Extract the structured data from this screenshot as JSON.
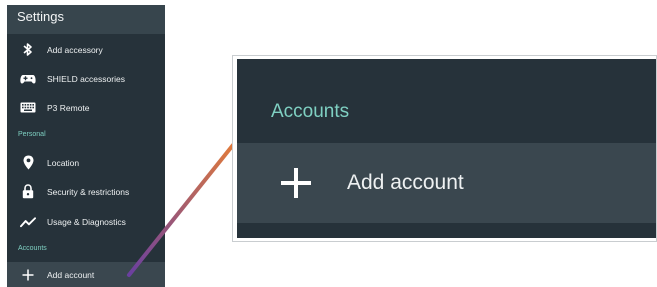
{
  "settings": {
    "title": "Settings",
    "items": [
      {
        "label": "Add accessory",
        "icon": "bluetooth-icon"
      },
      {
        "label": "SHIELD accessories",
        "icon": "gamepad-icon"
      },
      {
        "label": "P3 Remote",
        "icon": "keyboard-icon"
      }
    ],
    "personal": {
      "header": "Personal",
      "items": [
        {
          "label": "Location",
          "icon": "location-pin-icon"
        },
        {
          "label": "Security & restrictions",
          "icon": "lock-icon"
        },
        {
          "label": "Usage & Diagnostics",
          "icon": "trend-icon"
        }
      ]
    },
    "accounts": {
      "header": "Accounts",
      "items": [
        {
          "label": "Add account",
          "icon": "plus-icon"
        }
      ]
    }
  },
  "zoom": {
    "header": "Accounts",
    "item_label": "Add account",
    "item_icon": "plus-icon"
  },
  "colors": {
    "panel_bg": "#26323a",
    "selected_bg": "#3a474f",
    "accent_teal": "#7fd0c2",
    "connector_start": "#e07a3c",
    "connector_end": "#6a3fa0"
  }
}
